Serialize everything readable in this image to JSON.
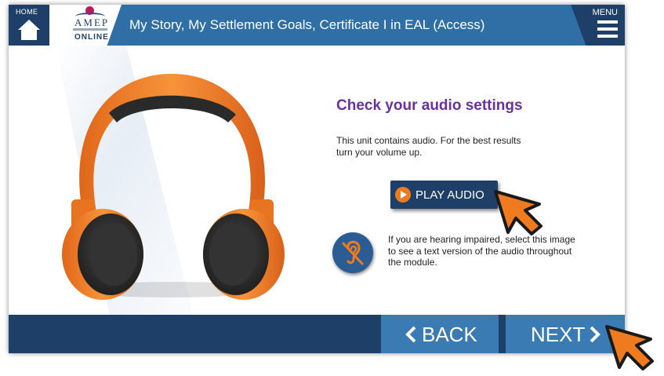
{
  "header": {
    "home_label": "HOME",
    "logo_text": "AMEP",
    "logo_sub": "ONLINE",
    "title": "My Story, My Settlement Goals, Certificate I in EAL (Access)",
    "menu_label": "MENU"
  },
  "main": {
    "heading": "Check your audio settings",
    "paragraph": "This unit contains audio. For the best results turn your volume up.",
    "play_label": "PLAY AUDIO",
    "hearing_text": "If you are hearing impaired, select this image to see a text version of the audio throughout the module."
  },
  "footer": {
    "back_label": "BACK",
    "next_label": "NEXT"
  },
  "icons": [
    "home-icon",
    "menu-icon",
    "headphones-image",
    "play-icon",
    "hearing-impaired-icon",
    "chevron-left-icon",
    "chevron-right-icon",
    "cursor-arrow-icon"
  ],
  "colors": {
    "header_blue": "#2f6fa5",
    "dark_navy": "#1d3f68",
    "nav_button": "#3b7bb3",
    "heading_purple": "#6b2fa0",
    "accent_orange": "#f07b1e"
  }
}
